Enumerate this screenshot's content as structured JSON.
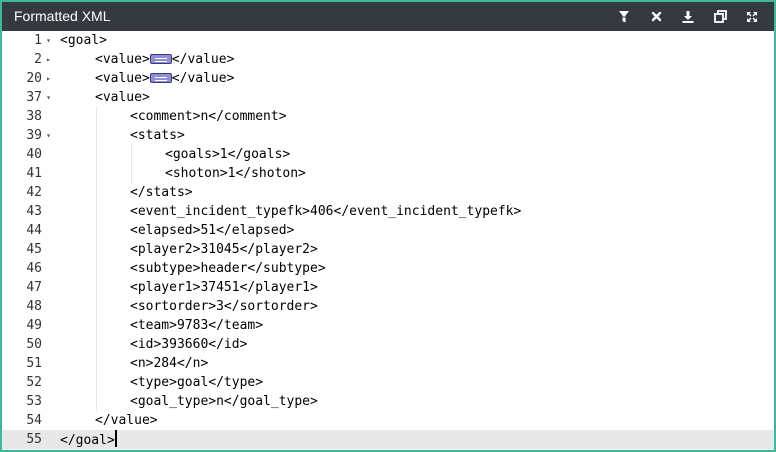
{
  "window": {
    "title": "Formatted XML"
  },
  "toolbar": {
    "icons": [
      "filter-icon",
      "clear-icon",
      "download-icon",
      "copy-icon",
      "fullscreen-icon"
    ]
  },
  "colors": {
    "border": "#3cb89a",
    "titlebar": "#343a40",
    "tag": "#000000",
    "active_line": "#e8e8e8"
  },
  "editor": {
    "active_line": "55",
    "lines": [
      {
        "num": "1",
        "fold": "▾",
        "indent": 0,
        "text": "<goal>"
      },
      {
        "num": "2",
        "fold": "▸",
        "indent": 1,
        "pre": "<value>",
        "folded": true,
        "post": "</value>"
      },
      {
        "num": "20",
        "fold": "▸",
        "indent": 1,
        "pre": "<value>",
        "folded": true,
        "post": "</value>"
      },
      {
        "num": "37",
        "fold": "▾",
        "indent": 1,
        "text": "<value>"
      },
      {
        "num": "38",
        "fold": "",
        "indent": 2,
        "text": "<comment>n</comment>"
      },
      {
        "num": "39",
        "fold": "▾",
        "indent": 2,
        "text": "<stats>"
      },
      {
        "num": "40",
        "fold": "",
        "indent": 3,
        "text": "<goals>1</goals>"
      },
      {
        "num": "41",
        "fold": "",
        "indent": 3,
        "text": "<shoton>1</shoton>"
      },
      {
        "num": "42",
        "fold": "",
        "indent": 2,
        "text": "</stats>"
      },
      {
        "num": "43",
        "fold": "",
        "indent": 2,
        "text": "<event_incident_typefk>406</event_incident_typefk>"
      },
      {
        "num": "44",
        "fold": "",
        "indent": 2,
        "text": "<elapsed>51</elapsed>"
      },
      {
        "num": "45",
        "fold": "",
        "indent": 2,
        "text": "<player2>31045</player2>"
      },
      {
        "num": "46",
        "fold": "",
        "indent": 2,
        "text": "<subtype>header</subtype>"
      },
      {
        "num": "47",
        "fold": "",
        "indent": 2,
        "text": "<player1>37451</player1>"
      },
      {
        "num": "48",
        "fold": "",
        "indent": 2,
        "text": "<sortorder>3</sortorder>"
      },
      {
        "num": "49",
        "fold": "",
        "indent": 2,
        "text": "<team>9783</team>"
      },
      {
        "num": "50",
        "fold": "",
        "indent": 2,
        "text": "<id>393660</id>"
      },
      {
        "num": "51",
        "fold": "",
        "indent": 2,
        "text": "<n>284</n>"
      },
      {
        "num": "52",
        "fold": "",
        "indent": 2,
        "text": "<type>goal</type>"
      },
      {
        "num": "53",
        "fold": "",
        "indent": 2,
        "text": "<goal_type>n</goal_type>"
      },
      {
        "num": "54",
        "fold": "",
        "indent": 1,
        "text": "</value>"
      },
      {
        "num": "55",
        "fold": "",
        "indent": 0,
        "text": "</goal>",
        "cursor": true
      }
    ]
  }
}
